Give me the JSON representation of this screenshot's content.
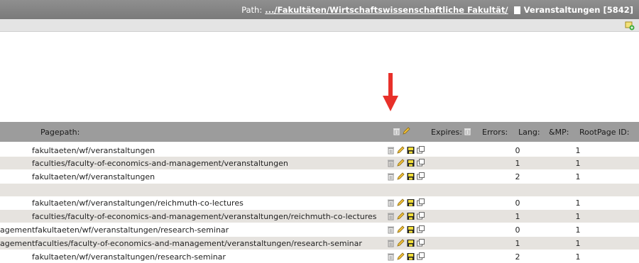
{
  "header": {
    "path_label": "Path:",
    "path_link": ".../Fakultäten/Wirtschaftswissenschaftliche Fakultät/",
    "page_title": "Veranstaltungen [5842]"
  },
  "table": {
    "columns": {
      "pagepath": "Pagepath:",
      "expires": "Expires:",
      "errors": "Errors:",
      "lang": "Lang:",
      "mp": "&MP:",
      "rootpage": "RootPage ID:"
    },
    "rows": [
      {
        "path": "fakultaeten/wf/veranstaltungen",
        "lang": "0",
        "mp": "1",
        "icons": true
      },
      {
        "path": "faculties/faculty-of-economics-and-management/veranstaltungen",
        "lang": "1",
        "mp": "1",
        "icons": true
      },
      {
        "path": "fakultaeten/wf/veranstaltungen",
        "lang": "2",
        "mp": "1",
        "icons": true
      },
      {
        "path": "",
        "lang": "",
        "mp": "",
        "icons": false
      },
      {
        "path": "fakultaeten/wf/veranstaltungen/reichmuth-co-lectures",
        "lang": "0",
        "mp": "1",
        "icons": true
      },
      {
        "path": "faculties/faculty-of-economics-and-management/veranstaltungen/reichmuth-co-lectures",
        "lang": "1",
        "mp": "1",
        "icons": true
      },
      {
        "path": "agementfakultaeten/wf/veranstaltungen/research-seminar",
        "lang": "0",
        "mp": "1",
        "icons": true
      },
      {
        "path": "agementfaculties/faculty-of-economics-and-management/veranstaltungen/research-seminar",
        "lang": "1",
        "mp": "1",
        "icons": true
      },
      {
        "path": "fakultaeten/wf/veranstaltungen/research-seminar",
        "lang": "2",
        "mp": "1",
        "icons": true
      }
    ]
  },
  "colors": {
    "arrow": "#e8302a",
    "header_bg": "#9c9c9c",
    "alt_row": "#e6e3df"
  }
}
